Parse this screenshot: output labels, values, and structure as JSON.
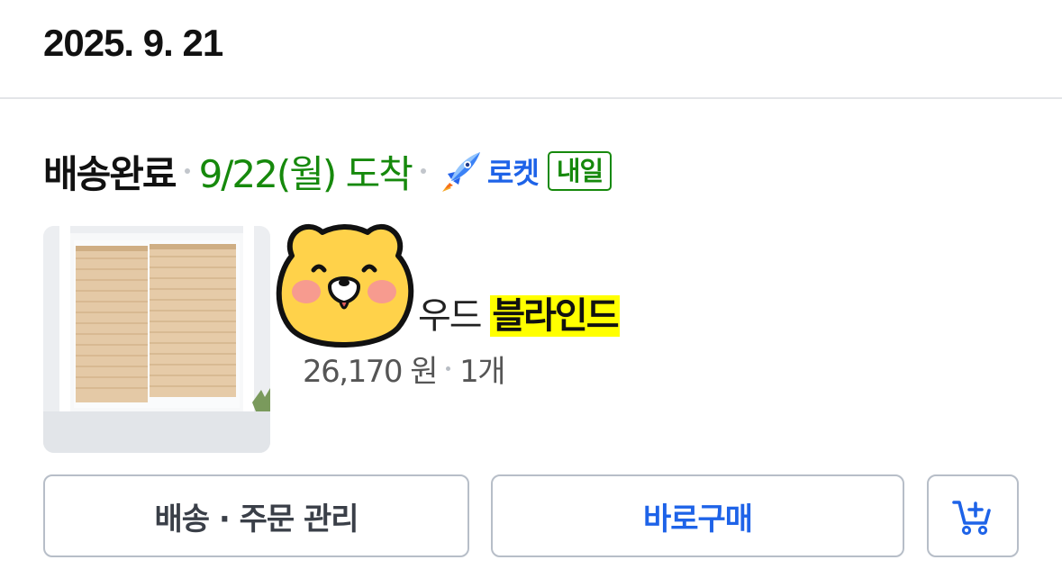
{
  "order": {
    "date": "2025. 9. 21",
    "status": "배송완료",
    "arrival": "9/22(월) 도착",
    "rocket_label": "로켓",
    "tomorrow_badge": "내일"
  },
  "product": {
    "name_prefix": "우드 ",
    "name_highlight": "블라인드",
    "price": "26,170 원",
    "quantity": "1개"
  },
  "actions": {
    "manage_label": "배송 · 주문 관리",
    "buy_now_label": "바로구매",
    "cart_icon": "add-to-cart-icon"
  },
  "colors": {
    "arrival_green": "#16890c",
    "rocket_blue": "#1e63e8",
    "highlight_yellow": "#ffff00",
    "button_border": "#b7bec8"
  }
}
